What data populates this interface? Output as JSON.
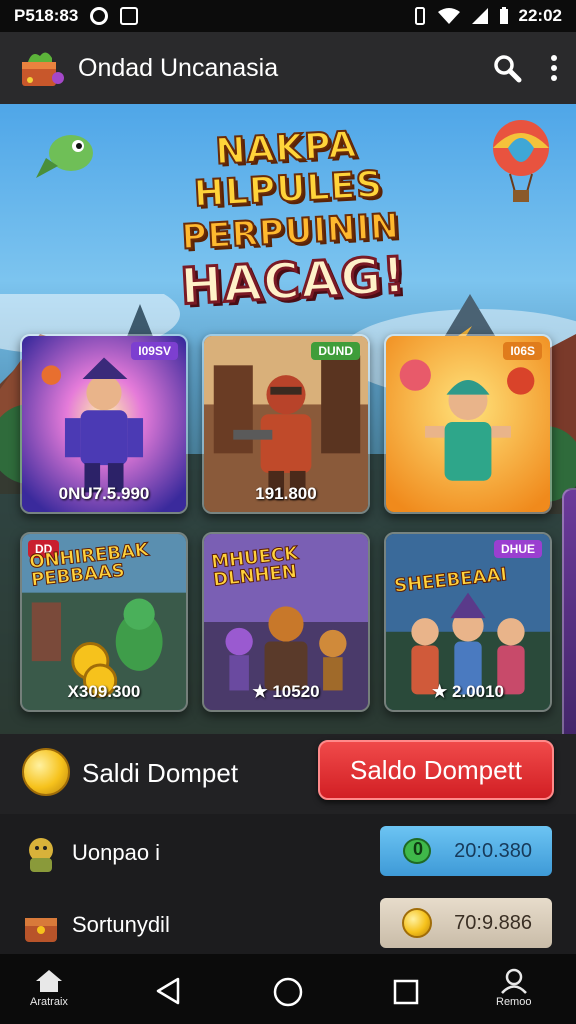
{
  "status_bar": {
    "left_text": "P518:83",
    "time": "22:02",
    "icons": [
      "whatsapp-icon",
      "image-icon",
      "vibrate-icon",
      "wifi-icon",
      "signal-icon",
      "battery-icon"
    ]
  },
  "app_bar": {
    "title": "Ondad Uncanasia",
    "icons": [
      "app-logo-icon",
      "search-icon",
      "more-vert-icon"
    ]
  },
  "hero": {
    "title_lines": [
      "NAKPA HLPULES",
      "PERPUININ",
      "HACAG!"
    ]
  },
  "cards": [
    {
      "badge": "I09SV",
      "badge_color": "#7d3fd0",
      "title": "",
      "value": "0NU7.5.990"
    },
    {
      "badge": "DUND",
      "badge_color": "#3f9d3a",
      "title": "",
      "value": "191.800"
    },
    {
      "badge": "I06S",
      "badge_color": "#e07c1c",
      "title": "",
      "value": ""
    },
    {
      "badge": "DD",
      "badge_color": "#c91f2f",
      "title": "ONHIREBAK PEBBAAS",
      "value": "X309.300"
    },
    {
      "badge": "",
      "badge_color": "",
      "title": "MHUECK DLNHEN",
      "value": "★ 10520"
    },
    {
      "badge": "DHUE",
      "badge_color": "#9a3fd0",
      "title": "SHEEBEAAI",
      "value": "★ 2.0010"
    }
  ],
  "balance": {
    "label": "Saldi Dompet",
    "button_label": "Saldo Dompett"
  },
  "list_rows": [
    {
      "label": "Uonpao i",
      "value": "20:0.380",
      "pill_icon_text": "0"
    },
    {
      "label": "Sortunydil",
      "value": "70:9.886",
      "pill_icon_text": ""
    }
  ],
  "nav": {
    "home_label": "Aratraix",
    "profile_label": "Remoo"
  },
  "colors": {
    "accent_red": "#d21f24",
    "pill_blue": "#4fa8e0",
    "pill_tan": "#d8ccb9",
    "coin_gold": "#f6c21c"
  }
}
